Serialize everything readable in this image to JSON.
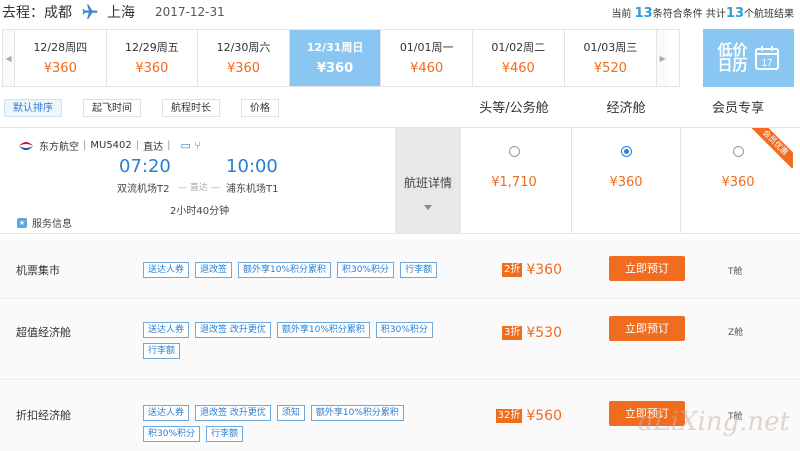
{
  "header": {
    "route_prefix": "去程：成都",
    "destination": "上海",
    "date": "2017-12-31",
    "summary_prefix": "当前",
    "match_count": "13",
    "summary_mid": "条符合条件 共计",
    "total_count": "13",
    "summary_suffix": "个航班结果"
  },
  "dates": [
    {
      "day": "12/28周四",
      "price": "¥360",
      "active": false
    },
    {
      "day": "12/29周五",
      "price": "¥360",
      "active": false
    },
    {
      "day": "12/30周六",
      "price": "¥360",
      "active": false
    },
    {
      "day": "12/31周日",
      "price": "¥360",
      "active": true
    },
    {
      "day": "01/01周一",
      "price": "¥460",
      "active": false
    },
    {
      "day": "01/02周二",
      "price": "¥460",
      "active": false
    },
    {
      "day": "01/03周三",
      "price": "¥520",
      "active": false
    }
  ],
  "calendar": {
    "label": "低价日历",
    "day": "17"
  },
  "sort": {
    "default": "默认排序",
    "depart": "起飞时间",
    "duration": "航程时长",
    "price": "价格"
  },
  "cabins": {
    "first": "头等/公务舱",
    "economy": "经济舱",
    "member": "会员专享"
  },
  "flight": {
    "airline": "东方航空",
    "flight_no": "MU5402",
    "type": "直达",
    "dep_time": "07:20",
    "arr_time": "10:00",
    "dep_airport": "双流机场T2",
    "direct": "— 直达 —",
    "arr_airport": "浦东机场T1",
    "duration": "2小时40分钟",
    "service": "服务信息",
    "detail": "航班详情",
    "first_price": "¥1,710",
    "economy_price": "¥360",
    "member_price": "¥360",
    "member_badge": "会员优惠"
  },
  "fares": [
    {
      "name": "机票集市",
      "tags": [
        "送达人券",
        "退改签",
        "额外享10%积分累积",
        "积30%积分",
        "行李额"
      ],
      "discount": "2折",
      "price": "¥360",
      "book": "立即预订",
      "class": "T舱"
    },
    {
      "name": "超值经济舱",
      "tags": [
        "送达人券",
        "退改签 改升更优",
        "额外享10%积分累积",
        "积30%积分",
        "行李额"
      ],
      "discount": "3折",
      "price": "¥530",
      "book": "立即预订",
      "class": "Z舱"
    },
    {
      "name": "折扣经济舱",
      "tags": [
        "送达人券",
        "退改签 改升更优",
        "须知",
        "额外享10%积分累积",
        "积30%积分",
        "行李额"
      ],
      "discount": "32折",
      "price": "¥560",
      "book": "立即预订",
      "class": "T舱"
    }
  ],
  "watermark": "aLiXing.net",
  "colors": {
    "accent": "#2a7fd0",
    "price": "#f06c1e",
    "active_date": "#89c6f2"
  }
}
